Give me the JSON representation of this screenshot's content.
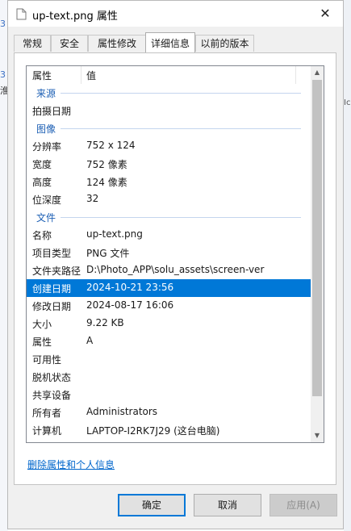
{
  "background": {
    "left_marks": [
      "3",
      "3",
      "淮"
    ],
    "right_marks": [
      "Ic"
    ]
  },
  "window": {
    "title": "up-text.png 属性",
    "close_glyph": "✕",
    "file_icon": "document-icon"
  },
  "tabs": [
    {
      "label": "常规",
      "active": false
    },
    {
      "label": "安全",
      "active": false
    },
    {
      "label": "属性修改",
      "active": false
    },
    {
      "label": "详细信息",
      "active": true
    },
    {
      "label": "以前的版本",
      "active": false
    }
  ],
  "details": {
    "columns": [
      "属性",
      "值"
    ],
    "items": [
      {
        "kind": "group",
        "title": "来源"
      },
      {
        "kind": "row",
        "name": "拍摄日期",
        "value": ""
      },
      {
        "kind": "group",
        "title": "图像"
      },
      {
        "kind": "row",
        "name": "分辨率",
        "value": "752 x 124"
      },
      {
        "kind": "row",
        "name": "宽度",
        "value": "752 像素"
      },
      {
        "kind": "row",
        "name": "高度",
        "value": "124 像素"
      },
      {
        "kind": "row",
        "name": "位深度",
        "value": "32"
      },
      {
        "kind": "group",
        "title": "文件"
      },
      {
        "kind": "row",
        "name": "名称",
        "value": "up-text.png"
      },
      {
        "kind": "row",
        "name": "项目类型",
        "value": "PNG 文件"
      },
      {
        "kind": "row",
        "name": "文件夹路径",
        "value": "D:\\Photo_APP\\solu_assets\\screen-ver"
      },
      {
        "kind": "row",
        "name": "创建日期",
        "value": "2024-10-21 23:56",
        "selected": true
      },
      {
        "kind": "row",
        "name": "修改日期",
        "value": "2024-08-17 16:06"
      },
      {
        "kind": "row",
        "name": "大小",
        "value": "9.22 KB"
      },
      {
        "kind": "row",
        "name": "属性",
        "value": "A"
      },
      {
        "kind": "row",
        "name": "可用性",
        "value": ""
      },
      {
        "kind": "row",
        "name": "脱机状态",
        "value": ""
      },
      {
        "kind": "row",
        "name": "共享设备",
        "value": ""
      },
      {
        "kind": "row",
        "name": "所有者",
        "value": "Administrators"
      },
      {
        "kind": "row",
        "name": "计算机",
        "value": "LAPTOP-I2RK7J29 (这台电脑)"
      }
    ]
  },
  "remove_link": "删除属性和个人信息",
  "buttons": {
    "ok": "确定",
    "cancel": "取消",
    "apply": "应用(A)"
  },
  "colors": {
    "selection": "#0078d7",
    "group_title": "#1c5fb4",
    "link": "#0066cc"
  }
}
